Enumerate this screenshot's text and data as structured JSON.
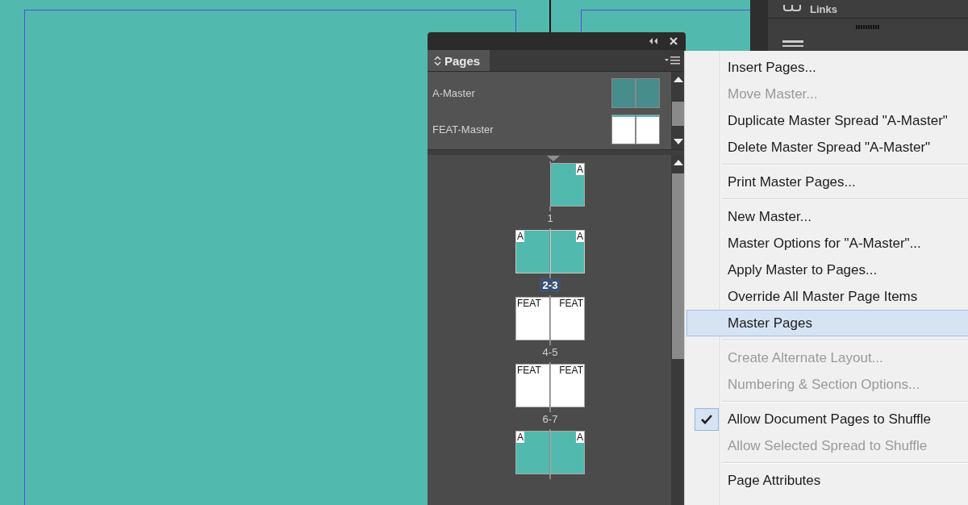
{
  "right_panel": {
    "label": "Links"
  },
  "pages_panel": {
    "tab": "Pages",
    "masters": [
      {
        "name": "A-Master",
        "kind": "teal"
      },
      {
        "name": "FEAT-Master",
        "kind": "white"
      }
    ],
    "spreads": [
      {
        "label": "1",
        "selected": false,
        "right_page": {
          "prefix": "A",
          "kind": "teal"
        }
      },
      {
        "label": "2-3",
        "selected": true,
        "left_page": {
          "prefix": "A",
          "kind": "teal"
        },
        "right_page": {
          "prefix": "A",
          "kind": "teal"
        }
      },
      {
        "label": "4-5",
        "selected": false,
        "left_page": {
          "prefix": "FEAT",
          "kind": "white"
        },
        "right_page": {
          "prefix": "FEAT",
          "kind": "white"
        }
      },
      {
        "label": "6-7",
        "selected": false,
        "left_page": {
          "prefix": "FEAT",
          "kind": "white"
        },
        "right_page": {
          "prefix": "FEAT",
          "kind": "white"
        }
      },
      {
        "selected": false,
        "left_page": {
          "prefix": "A",
          "kind": "teal"
        },
        "right_page": {
          "prefix": "A",
          "kind": "teal"
        }
      }
    ]
  },
  "menu": [
    {
      "kind": "item",
      "label": "Insert Pages...",
      "disabled": false,
      "selected": false,
      "checked": false
    },
    {
      "kind": "item",
      "label": "Move Master...",
      "disabled": true,
      "selected": false,
      "checked": false
    },
    {
      "kind": "item",
      "label": "Duplicate Master Spread \"A-Master\"",
      "disabled": false,
      "selected": false,
      "checked": false
    },
    {
      "kind": "item",
      "label": "Delete Master Spread \"A-Master\"",
      "disabled": false,
      "selected": false,
      "checked": false
    },
    {
      "kind": "separator"
    },
    {
      "kind": "item",
      "label": "Print Master Pages...",
      "disabled": false,
      "selected": false,
      "checked": false
    },
    {
      "kind": "separator"
    },
    {
      "kind": "item",
      "label": "New Master...",
      "disabled": false,
      "selected": false,
      "checked": false
    },
    {
      "kind": "item",
      "label": "Master Options for \"A-Master\"...",
      "disabled": false,
      "selected": false,
      "checked": false
    },
    {
      "kind": "item",
      "label": "Apply Master to Pages...",
      "disabled": false,
      "selected": false,
      "checked": false
    },
    {
      "kind": "item",
      "label": "Override All Master Page Items",
      "disabled": false,
      "selected": false,
      "checked": false
    },
    {
      "kind": "item",
      "label": "Master Pages",
      "disabled": false,
      "selected": true,
      "checked": false
    },
    {
      "kind": "separator"
    },
    {
      "kind": "item",
      "label": "Create Alternate Layout...",
      "disabled": true,
      "selected": false,
      "checked": false
    },
    {
      "kind": "item",
      "label": "Numbering & Section Options...",
      "disabled": true,
      "selected": false,
      "checked": false
    },
    {
      "kind": "separator"
    },
    {
      "kind": "item",
      "label": "Allow Document Pages to Shuffle",
      "disabled": false,
      "selected": false,
      "checked": true
    },
    {
      "kind": "item",
      "label": "Allow Selected Spread to Shuffle",
      "disabled": true,
      "selected": false,
      "checked": false
    },
    {
      "kind": "separator"
    },
    {
      "kind": "item",
      "label": "Page Attributes",
      "disabled": false,
      "selected": false,
      "checked": false
    }
  ]
}
